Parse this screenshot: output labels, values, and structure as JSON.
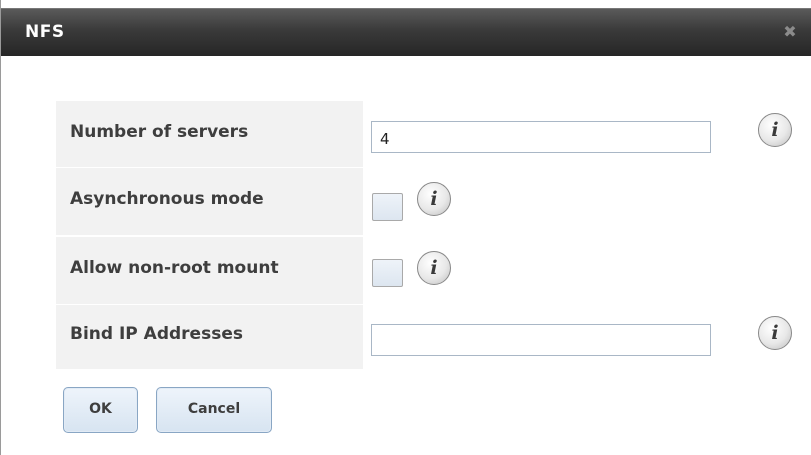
{
  "dialog": {
    "title": "NFS",
    "close_icon": "close-icon"
  },
  "fields": {
    "servers": {
      "label": "Number of servers",
      "value": "4"
    },
    "async": {
      "label": "Asynchronous mode",
      "checked": false
    },
    "nonroot": {
      "label": "Allow non-root mount",
      "checked": false
    },
    "bindip": {
      "label": "Bind IP Addresses",
      "value": ""
    }
  },
  "info_glyph": "i",
  "buttons": {
    "ok": "OK",
    "cancel": "Cancel"
  }
}
